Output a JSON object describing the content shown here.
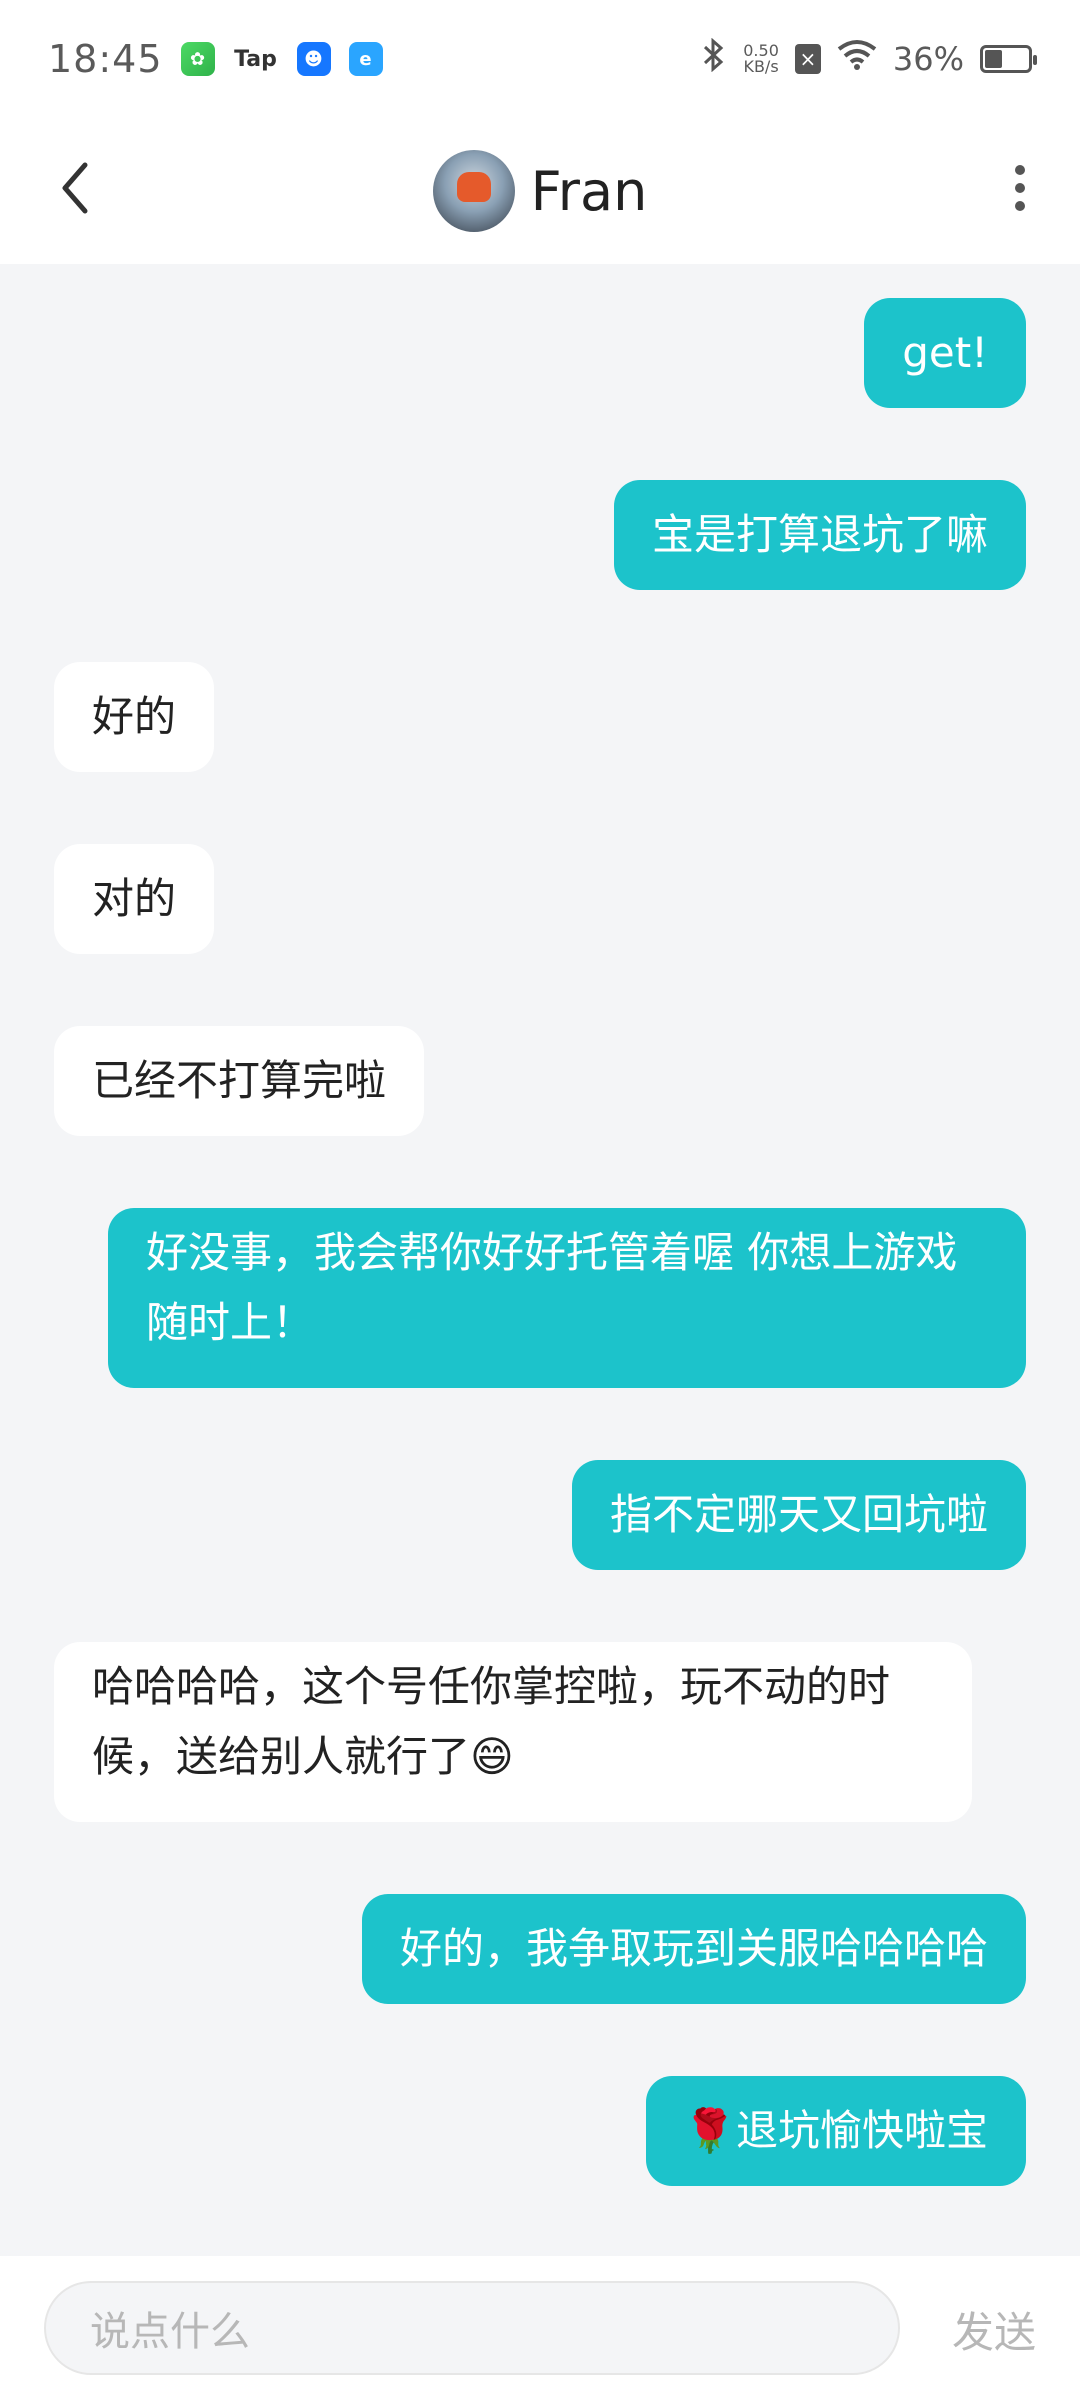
{
  "status_bar": {
    "time": "18:45",
    "app_icons": [
      "green-app-icon",
      "tap-icon",
      "blue-app-icon",
      "blue-app-icon-2"
    ],
    "tap_label": "Tap",
    "network_speed_value": "0.50",
    "network_speed_unit": "KB/s",
    "battery_percent": "36%",
    "battery_level": 0.36
  },
  "header": {
    "contact_name": "Fran"
  },
  "messages": [
    {
      "direction": "out",
      "text": "get!"
    },
    {
      "direction": "out",
      "text": "宝是打算退坑了嘛"
    },
    {
      "direction": "in",
      "text": "好的"
    },
    {
      "direction": "in",
      "text": "对的"
    },
    {
      "direction": "in",
      "text": "已经不打算完啦"
    },
    {
      "direction": "out",
      "text": "好没事，我会帮你好好托管着喔 你想上游戏随时上！"
    },
    {
      "direction": "out",
      "text": "指不定哪天又回坑啦"
    },
    {
      "direction": "in",
      "text": "哈哈哈哈，这个号任你掌控啦，玩不动的时候，送给别人就行了😄"
    },
    {
      "direction": "out",
      "text": "好的，我争取玩到关服哈哈哈哈"
    },
    {
      "direction": "out",
      "text": "🌹退坑愉快啦宝"
    }
  ],
  "input": {
    "placeholder": "说点什么",
    "send_label": "发送"
  },
  "colors": {
    "accent": "#1cc3cb",
    "background": "#f4f5f7"
  }
}
